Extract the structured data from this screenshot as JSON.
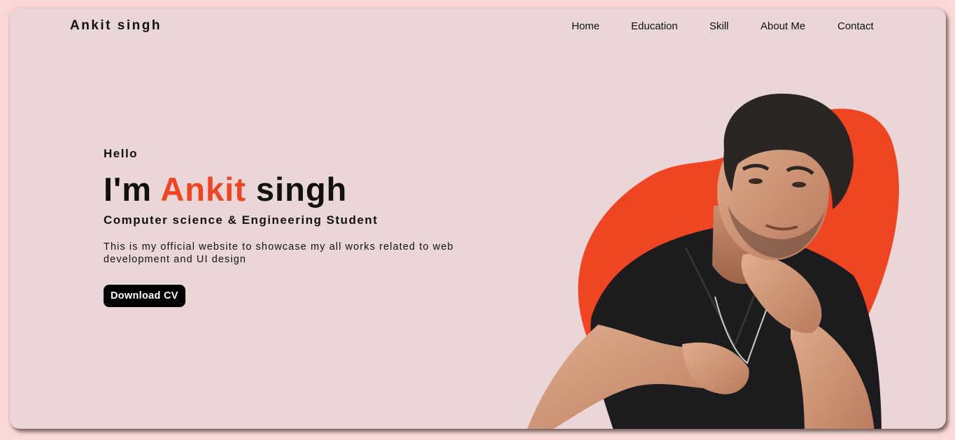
{
  "brand": "Ankit singh",
  "nav": [
    "Home",
    "Education",
    "Skill",
    "About Me",
    "Contact"
  ],
  "hero": {
    "greeting": "Hello",
    "title_prefix": "I'm",
    "title_accent": "Ankit",
    "title_suffix": "singh",
    "subtitle": "Computer science & Engineering Student",
    "description": "This is my official website to showcase my all works related to web development and UI design",
    "cta_label": "Download CV"
  },
  "colors": {
    "accent": "#f04523",
    "background": "#ead6d7",
    "text": "#111111"
  }
}
